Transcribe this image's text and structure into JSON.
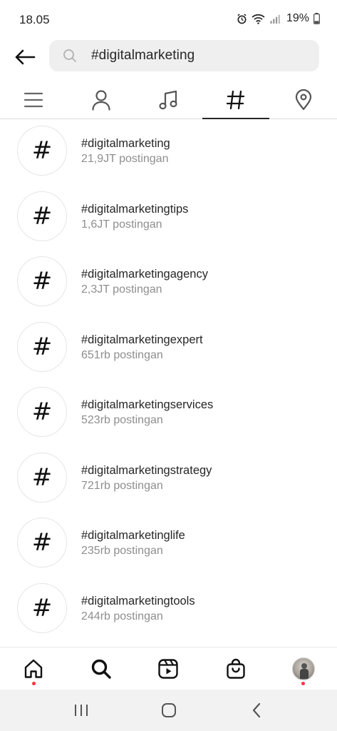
{
  "status_bar": {
    "time": "18.05",
    "battery": "19%",
    "icons": [
      "alarm-icon",
      "wifi-icon",
      "signal-icon",
      "battery-icon"
    ]
  },
  "search": {
    "value": "#digitalmarketing",
    "icon": "search-icon",
    "back_icon": "back-arrow-icon"
  },
  "tabs": [
    {
      "name": "tab-top",
      "icon": "list-icon",
      "active": false
    },
    {
      "name": "tab-accounts",
      "icon": "user-icon",
      "active": false
    },
    {
      "name": "tab-audio",
      "icon": "music-icon",
      "active": false
    },
    {
      "name": "tab-tags",
      "icon": "hashtag-icon",
      "active": true
    },
    {
      "name": "tab-places",
      "icon": "location-pin-icon",
      "active": false
    }
  ],
  "results": [
    {
      "tag": "#digitalmarketing",
      "count": "21,9JT postingan"
    },
    {
      "tag": "#digitalmarketingtips",
      "count": "1,6JT postingan"
    },
    {
      "tag": "#digitalmarketingagency",
      "count": "2,3JT postingan"
    },
    {
      "tag": "#digitalmarketingexpert",
      "count": "651rb postingan"
    },
    {
      "tag": "#digitalmarketingservices",
      "count": "523rb postingan"
    },
    {
      "tag": "#digitalmarketingstrategy",
      "count": "721rb postingan"
    },
    {
      "tag": "#digitalmarketinglife",
      "count": "235rb postingan"
    },
    {
      "tag": "#digitalmarketingtools",
      "count": "244rb postingan"
    }
  ],
  "hash_symbol": "#",
  "bottom_nav": [
    {
      "name": "nav-home",
      "icon": "home-icon",
      "dot": true
    },
    {
      "name": "nav-search",
      "icon": "search-icon",
      "dot": false
    },
    {
      "name": "nav-reels",
      "icon": "reels-icon",
      "dot": false
    },
    {
      "name": "nav-shop",
      "icon": "shop-bag-icon",
      "dot": false
    },
    {
      "name": "nav-profile",
      "icon": "avatar",
      "dot": true
    }
  ],
  "colors": {
    "accent_dot": "#ff3040",
    "text_primary": "#262626",
    "text_secondary": "#8e8e8e",
    "search_bg": "#efefef"
  }
}
